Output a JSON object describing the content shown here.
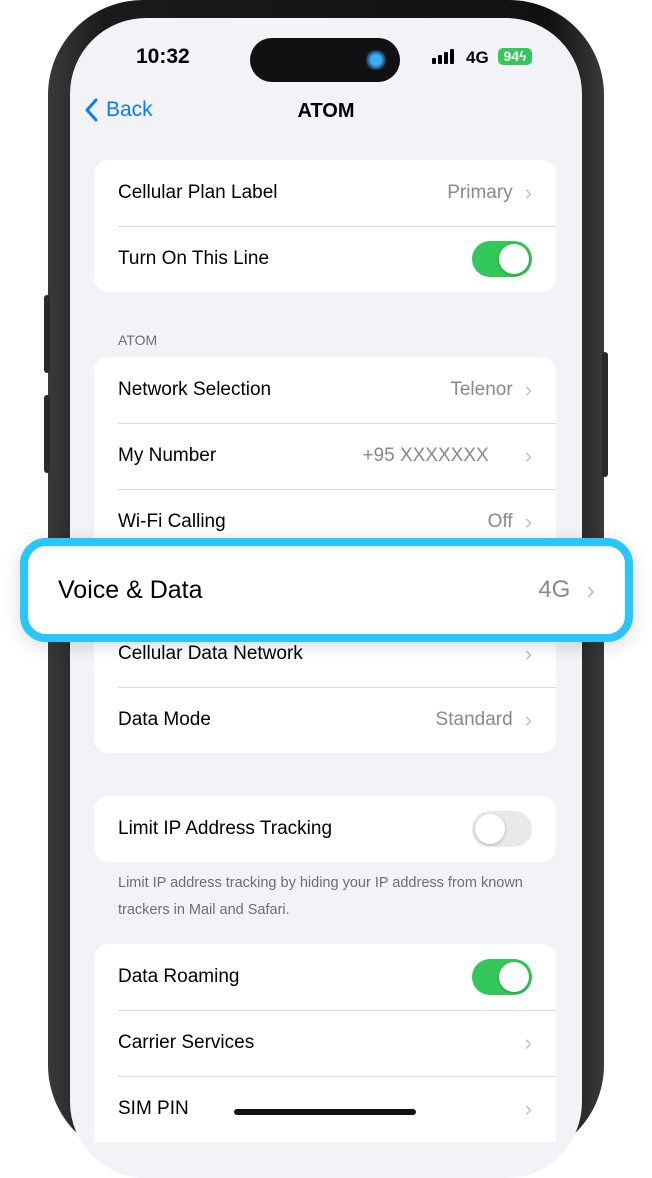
{
  "status": {
    "time": "10:32",
    "network": "4G",
    "battery": "94"
  },
  "nav": {
    "back": "Back",
    "title": "ATOM"
  },
  "group1": [
    {
      "label": "Cellular Plan Label",
      "value": "Primary"
    },
    {
      "label": "Turn On This Line",
      "toggle": true
    }
  ],
  "group2_header": "ATOM",
  "group2": [
    {
      "label": "Network Selection",
      "value": "Telenor"
    },
    {
      "label": "My Number",
      "value": "+95 XXXXXXX"
    },
    {
      "label": "Wi-Fi Calling",
      "value": "Off"
    },
    {
      "label": "Cellular Data Network"
    },
    {
      "label": "Data Mode",
      "value": "Standard"
    }
  ],
  "highlight": {
    "label": "Voice & Data",
    "value": "4G",
    "color": "#29c5fd"
  },
  "group3": {
    "label": "Limit IP Address Tracking",
    "toggle": false,
    "footer": "Limit IP address tracking by hiding your IP address from known trackers in Mail and Safari."
  },
  "group4": [
    {
      "label": "Data Roaming",
      "toggle": true
    },
    {
      "label": "Carrier Services"
    },
    {
      "label": "SIM PIN"
    }
  ],
  "colors": {
    "accent": "#0a7aff",
    "toggle_on": "#34c759",
    "background": "#f2f2f7"
  }
}
